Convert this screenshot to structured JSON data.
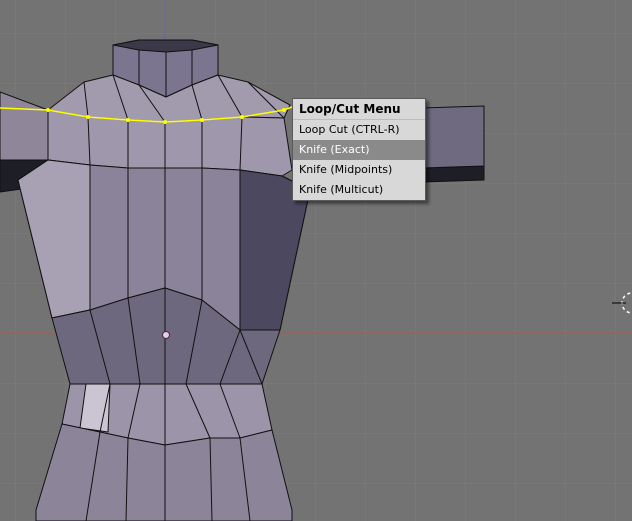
{
  "viewport": {
    "background_color": "#737373",
    "grid_color": "#7e7e7e",
    "axis_color": "#b3544c",
    "selection_color": "#ffff00"
  },
  "menu": {
    "title": "Loop/Cut Menu",
    "items": [
      {
        "label": "Loop Cut (CTRL-R)",
        "active": false
      },
      {
        "label": "Knife (Exact)",
        "active": true
      },
      {
        "label": "Knife (Midpoints)",
        "active": false
      },
      {
        "label": "Knife (Multicut)",
        "active": false
      }
    ]
  }
}
